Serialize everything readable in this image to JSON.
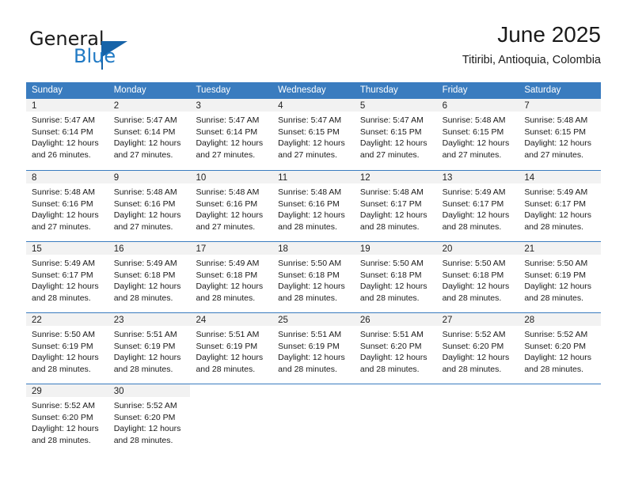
{
  "branding": {
    "word_general": "General",
    "word_blue": "Blue"
  },
  "header": {
    "title": "June 2025",
    "subtitle": "Titiribi, Antioquia, Colombia"
  },
  "colors": {
    "header_blue": "#3a7cbf",
    "logo_blue": "#1f79c4",
    "day_band_gray": "#f2f2f2"
  },
  "weekdays": [
    "Sunday",
    "Monday",
    "Tuesday",
    "Wednesday",
    "Thursday",
    "Friday",
    "Saturday"
  ],
  "weeks": [
    [
      {
        "day": "1",
        "sunrise": "Sunrise: 5:47 AM",
        "sunset": "Sunset: 6:14 PM",
        "daylight1": "Daylight: 12 hours",
        "daylight2": "and 26 minutes."
      },
      {
        "day": "2",
        "sunrise": "Sunrise: 5:47 AM",
        "sunset": "Sunset: 6:14 PM",
        "daylight1": "Daylight: 12 hours",
        "daylight2": "and 27 minutes."
      },
      {
        "day": "3",
        "sunrise": "Sunrise: 5:47 AM",
        "sunset": "Sunset: 6:14 PM",
        "daylight1": "Daylight: 12 hours",
        "daylight2": "and 27 minutes."
      },
      {
        "day": "4",
        "sunrise": "Sunrise: 5:47 AM",
        "sunset": "Sunset: 6:15 PM",
        "daylight1": "Daylight: 12 hours",
        "daylight2": "and 27 minutes."
      },
      {
        "day": "5",
        "sunrise": "Sunrise: 5:47 AM",
        "sunset": "Sunset: 6:15 PM",
        "daylight1": "Daylight: 12 hours",
        "daylight2": "and 27 minutes."
      },
      {
        "day": "6",
        "sunrise": "Sunrise: 5:48 AM",
        "sunset": "Sunset: 6:15 PM",
        "daylight1": "Daylight: 12 hours",
        "daylight2": "and 27 minutes."
      },
      {
        "day": "7",
        "sunrise": "Sunrise: 5:48 AM",
        "sunset": "Sunset: 6:15 PM",
        "daylight1": "Daylight: 12 hours",
        "daylight2": "and 27 minutes."
      }
    ],
    [
      {
        "day": "8",
        "sunrise": "Sunrise: 5:48 AM",
        "sunset": "Sunset: 6:16 PM",
        "daylight1": "Daylight: 12 hours",
        "daylight2": "and 27 minutes."
      },
      {
        "day": "9",
        "sunrise": "Sunrise: 5:48 AM",
        "sunset": "Sunset: 6:16 PM",
        "daylight1": "Daylight: 12 hours",
        "daylight2": "and 27 minutes."
      },
      {
        "day": "10",
        "sunrise": "Sunrise: 5:48 AM",
        "sunset": "Sunset: 6:16 PM",
        "daylight1": "Daylight: 12 hours",
        "daylight2": "and 27 minutes."
      },
      {
        "day": "11",
        "sunrise": "Sunrise: 5:48 AM",
        "sunset": "Sunset: 6:16 PM",
        "daylight1": "Daylight: 12 hours",
        "daylight2": "and 28 minutes."
      },
      {
        "day": "12",
        "sunrise": "Sunrise: 5:48 AM",
        "sunset": "Sunset: 6:17 PM",
        "daylight1": "Daylight: 12 hours",
        "daylight2": "and 28 minutes."
      },
      {
        "day": "13",
        "sunrise": "Sunrise: 5:49 AM",
        "sunset": "Sunset: 6:17 PM",
        "daylight1": "Daylight: 12 hours",
        "daylight2": "and 28 minutes."
      },
      {
        "day": "14",
        "sunrise": "Sunrise: 5:49 AM",
        "sunset": "Sunset: 6:17 PM",
        "daylight1": "Daylight: 12 hours",
        "daylight2": "and 28 minutes."
      }
    ],
    [
      {
        "day": "15",
        "sunrise": "Sunrise: 5:49 AM",
        "sunset": "Sunset: 6:17 PM",
        "daylight1": "Daylight: 12 hours",
        "daylight2": "and 28 minutes."
      },
      {
        "day": "16",
        "sunrise": "Sunrise: 5:49 AM",
        "sunset": "Sunset: 6:18 PM",
        "daylight1": "Daylight: 12 hours",
        "daylight2": "and 28 minutes."
      },
      {
        "day": "17",
        "sunrise": "Sunrise: 5:49 AM",
        "sunset": "Sunset: 6:18 PM",
        "daylight1": "Daylight: 12 hours",
        "daylight2": "and 28 minutes."
      },
      {
        "day": "18",
        "sunrise": "Sunrise: 5:50 AM",
        "sunset": "Sunset: 6:18 PM",
        "daylight1": "Daylight: 12 hours",
        "daylight2": "and 28 minutes."
      },
      {
        "day": "19",
        "sunrise": "Sunrise: 5:50 AM",
        "sunset": "Sunset: 6:18 PM",
        "daylight1": "Daylight: 12 hours",
        "daylight2": "and 28 minutes."
      },
      {
        "day": "20",
        "sunrise": "Sunrise: 5:50 AM",
        "sunset": "Sunset: 6:18 PM",
        "daylight1": "Daylight: 12 hours",
        "daylight2": "and 28 minutes."
      },
      {
        "day": "21",
        "sunrise": "Sunrise: 5:50 AM",
        "sunset": "Sunset: 6:19 PM",
        "daylight1": "Daylight: 12 hours",
        "daylight2": "and 28 minutes."
      }
    ],
    [
      {
        "day": "22",
        "sunrise": "Sunrise: 5:50 AM",
        "sunset": "Sunset: 6:19 PM",
        "daylight1": "Daylight: 12 hours",
        "daylight2": "and 28 minutes."
      },
      {
        "day": "23",
        "sunrise": "Sunrise: 5:51 AM",
        "sunset": "Sunset: 6:19 PM",
        "daylight1": "Daylight: 12 hours",
        "daylight2": "and 28 minutes."
      },
      {
        "day": "24",
        "sunrise": "Sunrise: 5:51 AM",
        "sunset": "Sunset: 6:19 PM",
        "daylight1": "Daylight: 12 hours",
        "daylight2": "and 28 minutes."
      },
      {
        "day": "25",
        "sunrise": "Sunrise: 5:51 AM",
        "sunset": "Sunset: 6:19 PM",
        "daylight1": "Daylight: 12 hours",
        "daylight2": "and 28 minutes."
      },
      {
        "day": "26",
        "sunrise": "Sunrise: 5:51 AM",
        "sunset": "Sunset: 6:20 PM",
        "daylight1": "Daylight: 12 hours",
        "daylight2": "and 28 minutes."
      },
      {
        "day": "27",
        "sunrise": "Sunrise: 5:52 AM",
        "sunset": "Sunset: 6:20 PM",
        "daylight1": "Daylight: 12 hours",
        "daylight2": "and 28 minutes."
      },
      {
        "day": "28",
        "sunrise": "Sunrise: 5:52 AM",
        "sunset": "Sunset: 6:20 PM",
        "daylight1": "Daylight: 12 hours",
        "daylight2": "and 28 minutes."
      }
    ],
    [
      {
        "day": "29",
        "sunrise": "Sunrise: 5:52 AM",
        "sunset": "Sunset: 6:20 PM",
        "daylight1": "Daylight: 12 hours",
        "daylight2": "and 28 minutes."
      },
      {
        "day": "30",
        "sunrise": "Sunrise: 5:52 AM",
        "sunset": "Sunset: 6:20 PM",
        "daylight1": "Daylight: 12 hours",
        "daylight2": "and 28 minutes."
      },
      {
        "day": "",
        "sunrise": "",
        "sunset": "",
        "daylight1": "",
        "daylight2": ""
      },
      {
        "day": "",
        "sunrise": "",
        "sunset": "",
        "daylight1": "",
        "daylight2": ""
      },
      {
        "day": "",
        "sunrise": "",
        "sunset": "",
        "daylight1": "",
        "daylight2": ""
      },
      {
        "day": "",
        "sunrise": "",
        "sunset": "",
        "daylight1": "",
        "daylight2": ""
      },
      {
        "day": "",
        "sunrise": "",
        "sunset": "",
        "daylight1": "",
        "daylight2": ""
      }
    ]
  ]
}
